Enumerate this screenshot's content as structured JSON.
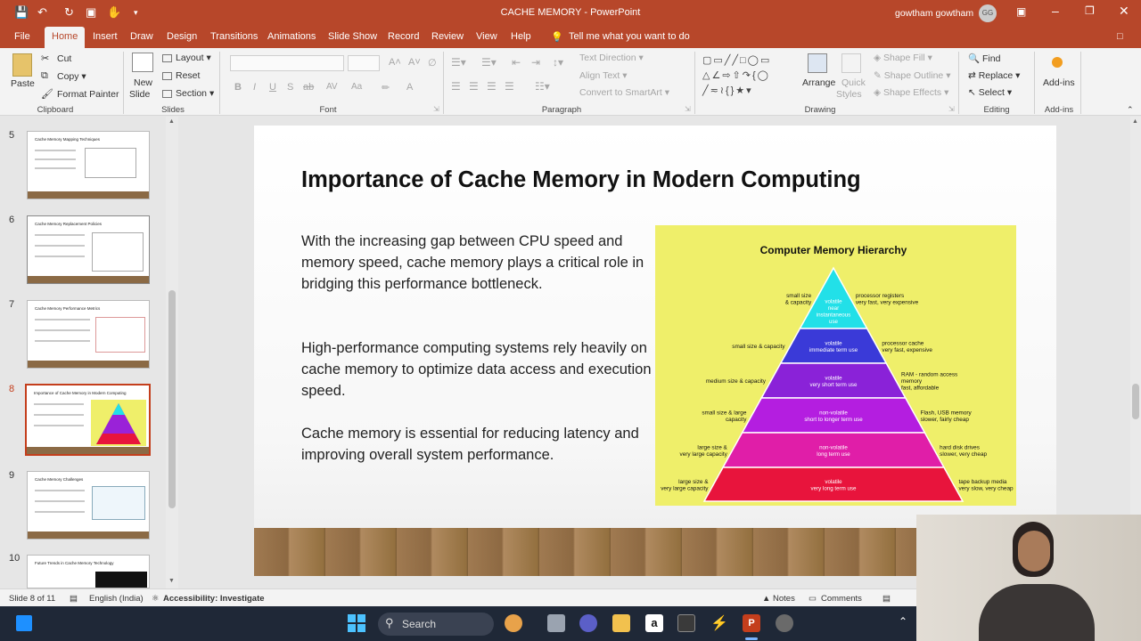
{
  "window": {
    "title": "CACHE MEMORY  -  PowerPoint",
    "user": "gowtham gowtham",
    "user_initials": "GG"
  },
  "menu": {
    "tabs": [
      "File",
      "Home",
      "Insert",
      "Draw",
      "Design",
      "Transitions",
      "Animations",
      "Slide Show",
      "Record",
      "Review",
      "View",
      "Help"
    ],
    "tell_me": "Tell me what you want to do"
  },
  "ribbon": {
    "clipboard": {
      "paste": "Paste",
      "cut": "Cut",
      "copy": "Copy",
      "format_painter": "Format Painter",
      "label": "Clipboard"
    },
    "slides": {
      "new_slide_1": "New",
      "new_slide_2": "Slide",
      "layout": "Layout",
      "reset": "Reset",
      "section": "Section",
      "label": "Slides"
    },
    "font": {
      "label": "Font"
    },
    "paragraph": {
      "text_direction": "Text Direction",
      "align_text": "Align Text",
      "convert_smartart": "Convert to SmartArt",
      "label": "Paragraph"
    },
    "drawing": {
      "arrange": "Arrange",
      "quick_styles_1": "Quick",
      "quick_styles_2": "Styles",
      "shape_fill": "Shape Fill",
      "shape_outline": "Shape Outline",
      "shape_effects": "Shape Effects",
      "label": "Drawing"
    },
    "editing": {
      "find": "Find",
      "replace": "Replace",
      "select": "Select",
      "label": "Editing"
    },
    "addins": {
      "addins": "Add-ins",
      "label": "Add-ins"
    }
  },
  "thumbnails": [
    {
      "num": "5",
      "title": "Cache Memory Mapping Techniques"
    },
    {
      "num": "6",
      "title": "Cache Memory Replacement Policies"
    },
    {
      "num": "7",
      "title": "Cache Memory Performance Metrics"
    },
    {
      "num": "8",
      "title": "Importance of Cache Memory in Modern Computing"
    },
    {
      "num": "9",
      "title": "Cache Memory Challenges"
    },
    {
      "num": "10",
      "title": "Future Trends in Cache Memory Technology"
    }
  ],
  "slide": {
    "title": "Importance of Cache Memory in Modern Computing",
    "bullets": [
      "With the increasing gap between CPU speed and memory speed, cache memory plays a critical role in bridging this performance bottleneck.",
      "High-performance computing systems rely heavily on cache memory to optimize data access and execution speed.",
      "Cache memory is essential for reducing latency and improving overall system performance."
    ],
    "figure": {
      "title": "Computer Memory Hierarchy",
      "levels": [
        {
          "inner": "volatile\nnear\ninstantaneous\nuse",
          "left": "small size\n& capacity",
          "right": "processor registers\nvery fast, very expensive",
          "color": "#22e0e8"
        },
        {
          "inner": "volatile\nimmediate term use",
          "left": "small size & capacity",
          "right": "processor cache\nvery fast, expensive",
          "color": "#3a3ad8"
        },
        {
          "inner": "volatile\nvery short term use",
          "left": "medium size & capacity",
          "right": "RAM - random access\nmemory\nfast, affordable",
          "color": "#8a22d8"
        },
        {
          "inner": "non-volatile\nshort to longer term use",
          "left": "small size & large\ncapacity",
          "right": "Flash, USB memory\nslower, fairly cheap",
          "color": "#b41ee0"
        },
        {
          "inner": "non-volatile\nlong term use",
          "left": "large size &\nvery large capacity",
          "right": "hard disk drives\nslower, very cheap",
          "color": "#e01ea8"
        },
        {
          "inner": "volatile\nvery long term use",
          "left": "large size &\nvery large capacity",
          "right": "tape backup media\nvery slow, very cheap",
          "color": "#e8143c"
        }
      ]
    }
  },
  "status": {
    "slide_count": "Slide 8 of 11",
    "language": "English (India)",
    "accessibility": "Accessibility: Investigate",
    "notes": "Notes",
    "comments": "Comments"
  },
  "taskbar": {
    "search": "Search"
  }
}
